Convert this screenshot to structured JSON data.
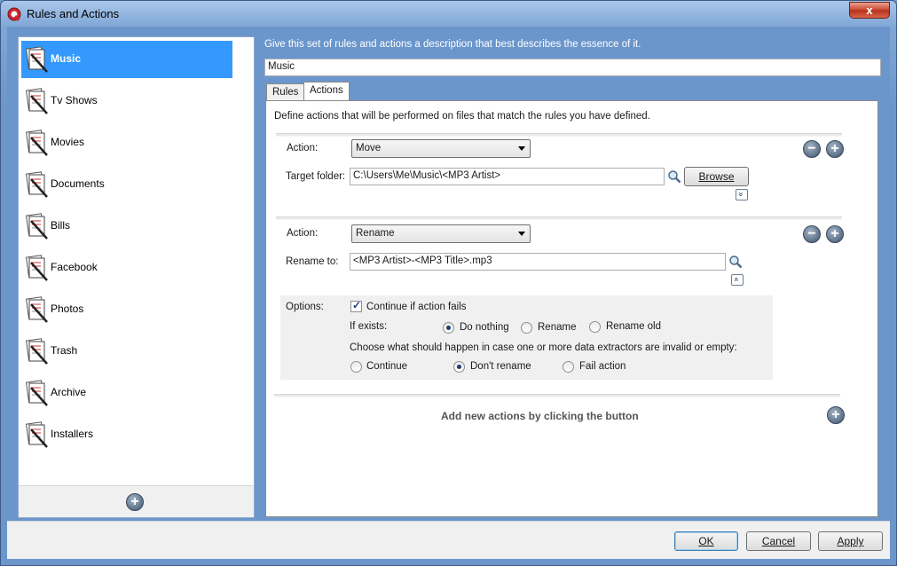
{
  "window": {
    "title": "Rules and Actions",
    "close_label": "x"
  },
  "sidebar": {
    "items": [
      {
        "label": "Music",
        "selected": true
      },
      {
        "label": "Tv Shows"
      },
      {
        "label": "Movies"
      },
      {
        "label": "Documents"
      },
      {
        "label": "Bills"
      },
      {
        "label": "Facebook"
      },
      {
        "label": "Photos"
      },
      {
        "label": "Trash"
      },
      {
        "label": "Archive"
      },
      {
        "label": "Installers"
      }
    ],
    "add_icon": "plus-circle-icon"
  },
  "description": {
    "label": "Give this set of rules and actions a description that best describes the essence of it.",
    "value": "Music"
  },
  "tabs": [
    {
      "label": "Rules"
    },
    {
      "label": "Actions",
      "active": true
    }
  ],
  "actions_panel": {
    "intro": "Define actions that will be performed on files that match the rules you have defined.",
    "action1": {
      "action_label": "Action:",
      "action_value": "Move",
      "target_label": "Target folder:",
      "target_value": "C:\\Users\\Me\\Music\\<MP3 Artist>",
      "browse_label": "Browse",
      "expand_glyph": "»"
    },
    "action2": {
      "action_label": "Action:",
      "action_value": "Rename",
      "rename_label": "Rename to:",
      "rename_value": "<MP3 Artist>-<MP3 Title>.mp3",
      "collapse_glyph": "«"
    },
    "options": {
      "label": "Options:",
      "continue_if_fails": "Continue if action fails",
      "continue_checked": true,
      "if_exists_label": "If exists:",
      "if_exists_options": [
        "Do nothing",
        "Rename",
        "Rename old"
      ],
      "if_exists_selected": "Do nothing",
      "extractors_label": "Choose what should happen in case one or more data extractors are invalid or empty:",
      "extractor_options": [
        "Continue",
        "Don't rename",
        "Fail action"
      ],
      "extractor_selected": "Don't rename"
    },
    "add_hint": "Add new actions by clicking the button",
    "remove_glyph": "−",
    "add_glyph": "+"
  },
  "footer": {
    "ok": "OK",
    "cancel": "Cancel",
    "apply": "Apply"
  },
  "colors": {
    "selection": "#3399ff",
    "frame": "#6b96cc"
  }
}
